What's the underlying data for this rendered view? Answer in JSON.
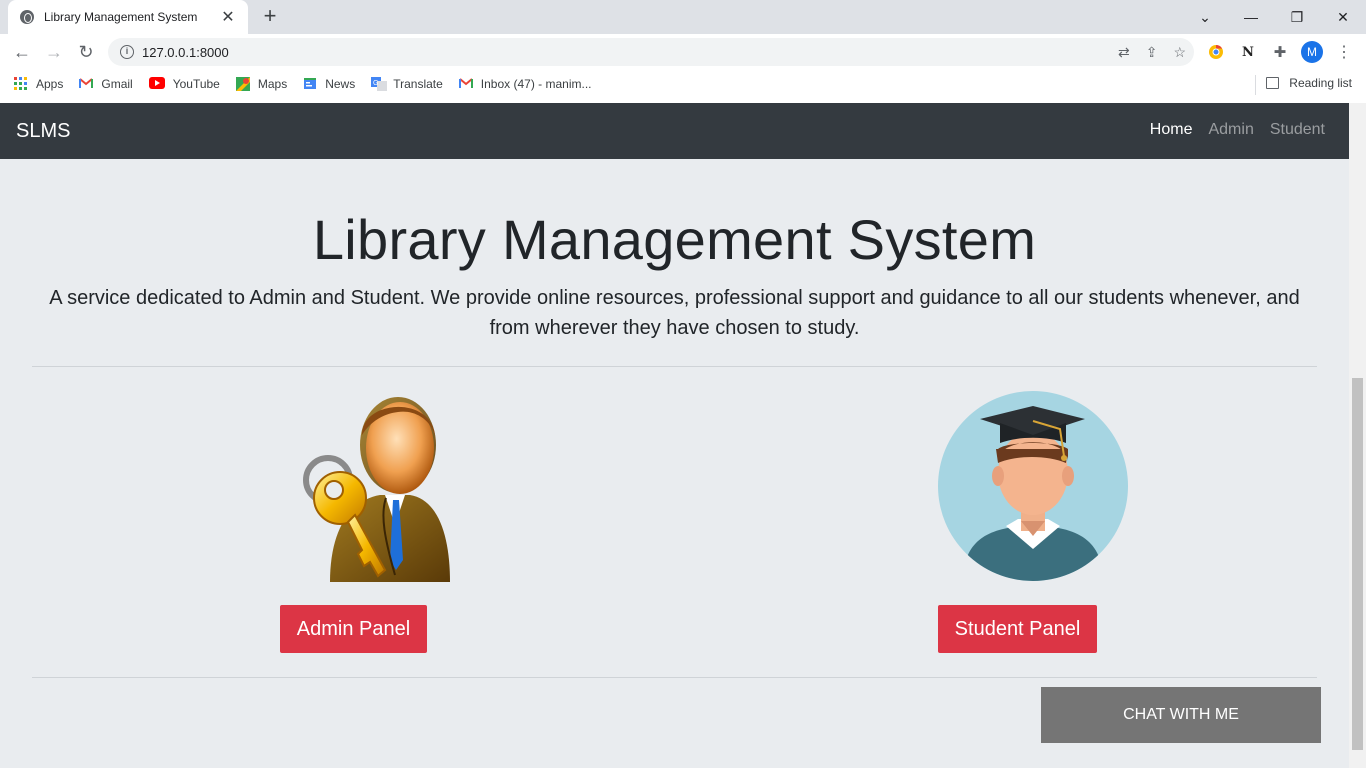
{
  "browser": {
    "tab_title": "Library Management System",
    "url": "127.0.0.1:8000",
    "profile_initial": "M",
    "extension_n": "N",
    "bookmarks": [
      {
        "label": "Apps",
        "icon": "apps-grid-icon",
        "color": "#ea4335"
      },
      {
        "label": "Gmail",
        "icon": "gmail-icon",
        "color": "#ea4335"
      },
      {
        "label": "YouTube",
        "icon": "youtube-icon",
        "color": "#ff0000"
      },
      {
        "label": "Maps",
        "icon": "maps-icon",
        "color": "#34a853"
      },
      {
        "label": "News",
        "icon": "news-icon",
        "color": "#4285f4"
      },
      {
        "label": "Translate",
        "icon": "translate-icon",
        "color": "#4285f4"
      },
      {
        "label": "Inbox (47) - manim...",
        "icon": "gmail-icon",
        "color": "#ea4335"
      }
    ],
    "reading_list": "Reading list"
  },
  "navbar": {
    "brand": "SLMS",
    "links": [
      "Home",
      "Admin",
      "Student"
    ],
    "bg_color": "#343a40"
  },
  "hero": {
    "title": "Library Management System",
    "lead_line1": "A service dedicated to Admin and Student. We provide online resources, professional support and guidance to all our students whenever, and",
    "lead_line2": "from wherever they have chosen to study."
  },
  "panels": {
    "admin_button": "Admin Panel",
    "student_button": "Student Panel",
    "button_color": "#dc3545"
  },
  "chat_button": "CHAT WITH ME"
}
